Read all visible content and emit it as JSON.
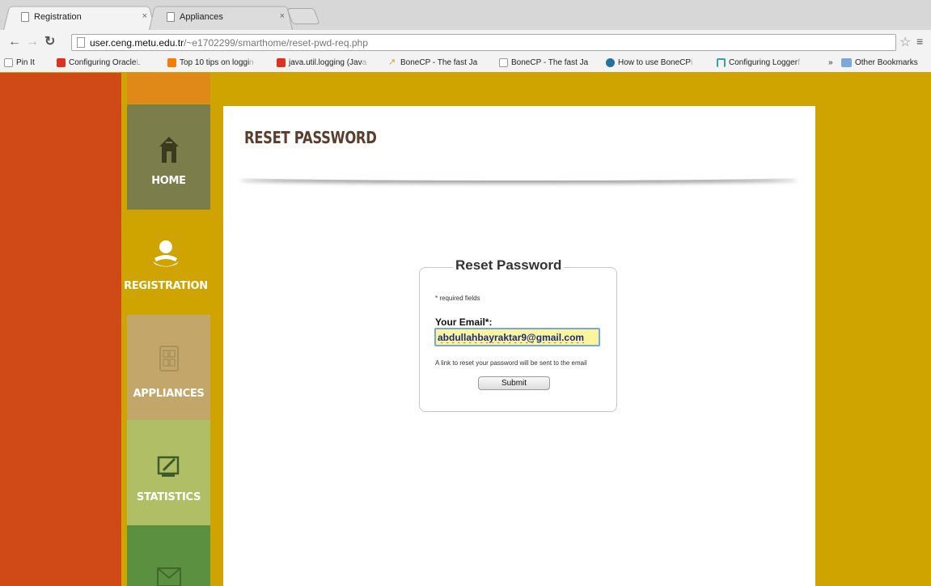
{
  "browser": {
    "tabs": [
      {
        "title": "Registration",
        "close": "×"
      },
      {
        "title": "Appliances",
        "close": "×"
      }
    ],
    "url": {
      "host": "user.ceng.metu.edu.tr",
      "path": "/~e1702299/smarthome/reset-pwd-req.php"
    },
    "bookmarks": [
      {
        "label": "Pin It",
        "dim": ""
      },
      {
        "label": "Configuring Oracle",
        "dim": " L"
      },
      {
        "label": "Top 10 tips on loggi",
        "dim": "n"
      },
      {
        "label": "java.util.logging (Jav",
        "dim": "a"
      },
      {
        "label": "BoneCP - The fast Ja",
        "dim": ""
      },
      {
        "label": "BoneCP - The fast Ja",
        "dim": ""
      },
      {
        "label": "How to use BoneCP",
        "dim": " i"
      },
      {
        "label": "Configuring Logger",
        "dim": " f"
      }
    ],
    "overflow_label": "»",
    "other_bookmarks": "Other Bookmarks",
    "colors": {
      "oracle": "#e0301e",
      "blogger": "#f57d00",
      "wordpress": "#21759b",
      "hubpages": "#3aa0a0"
    }
  },
  "nav": {
    "home": "HOME",
    "registration": "REGISTRATION",
    "appliances": "APPLIANCES",
    "statistics": "STATISTICS",
    "icons": {
      "home": "house-icon",
      "registration": "user-icon",
      "appliances": "appliance-icon",
      "statistics": "chart-icon",
      "contact": "envelope-icon"
    }
  },
  "page": {
    "title": "RESET PASSWORD",
    "form": {
      "legend": "Reset Password",
      "required_note": "* required fields",
      "email_label": "Your Email*:",
      "email_value": "abdullahbayraktar9@gmail.com",
      "reset_note": "A link to reset your password will be sent to the email",
      "submit_label": "Submit"
    }
  },
  "colors": {
    "orange_red": "#cf4a17",
    "mustard": "#cfa300",
    "title_brown": "#5a3d2b"
  }
}
